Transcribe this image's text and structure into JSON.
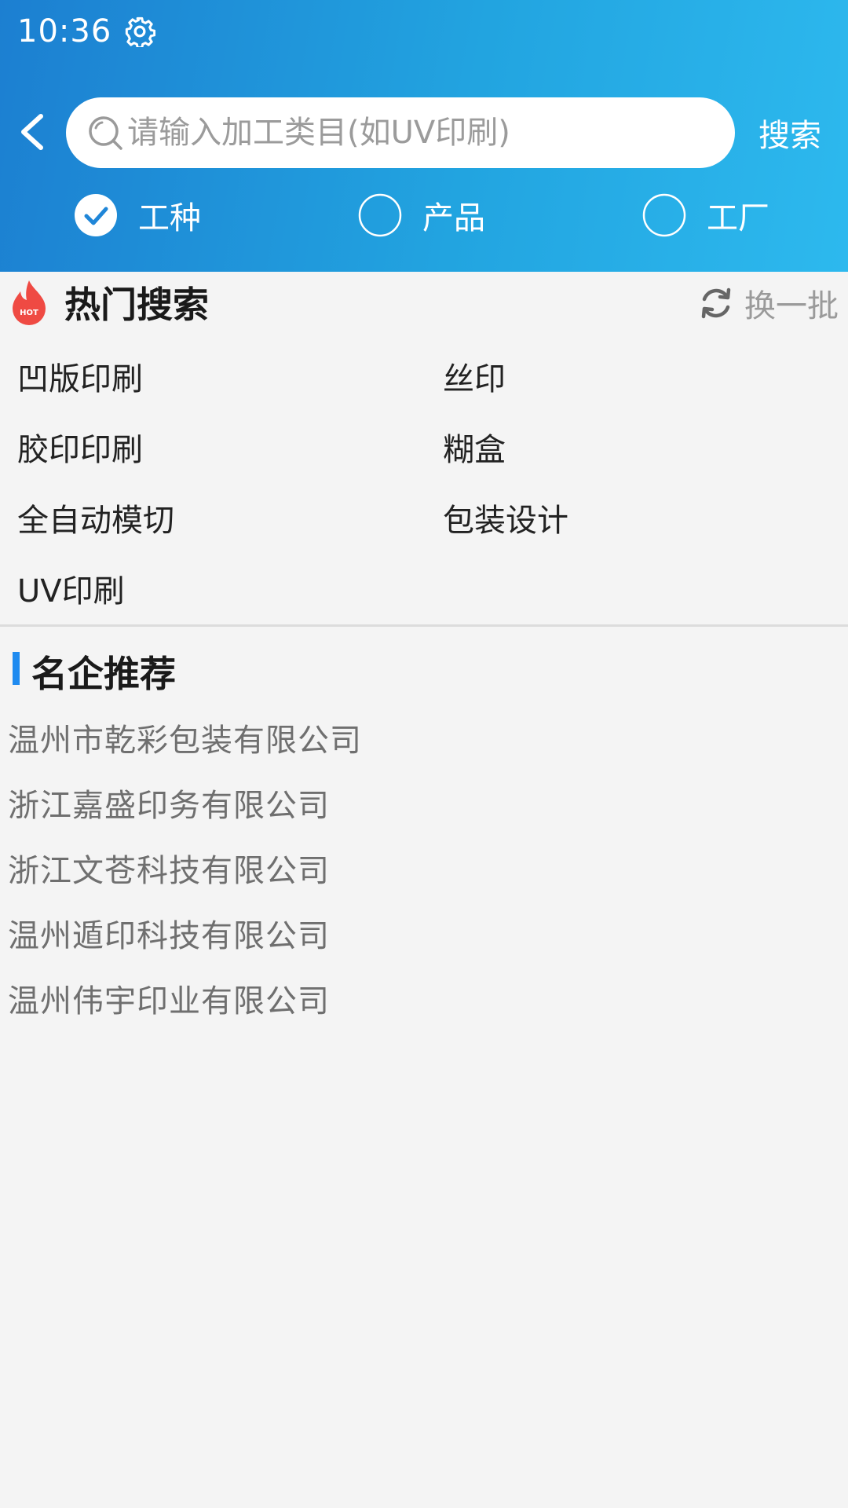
{
  "status_bar": {
    "time": "10:36",
    "settings_icon": "gear-icon"
  },
  "search": {
    "placeholder": "请输入加工类目(如UV印刷)",
    "value": "",
    "button_label": "搜索",
    "back_icon": "chevron-left-icon",
    "search_icon": "search-icon"
  },
  "filter": {
    "options": [
      {
        "label": "工种",
        "selected": true
      },
      {
        "label": "产品",
        "selected": false
      },
      {
        "label": "工厂",
        "selected": false
      }
    ]
  },
  "hot_search": {
    "title": "热门搜索",
    "badge_text": "HOT",
    "refresh_label": "换一批",
    "items": [
      "凹版印刷",
      "丝印",
      "胶印印刷",
      "糊盒",
      "全自动模切",
      "包装设计",
      "UV印刷"
    ]
  },
  "recommend": {
    "title": "名企推荐",
    "companies": [
      "温州市乾彩包装有限公司",
      "浙江嘉盛印务有限公司",
      "浙江文苍科技有限公司",
      "温州遁印科技有限公司",
      "温州伟宇印业有限公司"
    ]
  },
  "colors": {
    "header_gradient_start": "#1c7fd1",
    "header_gradient_end": "#2db9ee",
    "accent": "#1f8bf0",
    "hot_red": "#ef4a43",
    "background": "#f4f4f4"
  }
}
